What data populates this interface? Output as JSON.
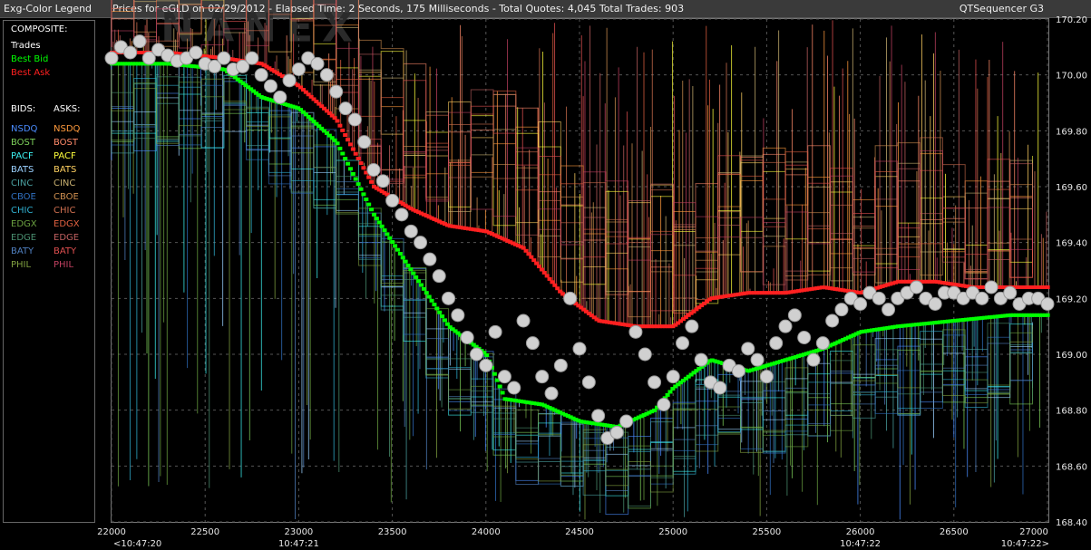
{
  "window": {
    "legend_title": "Exg-Color Legend",
    "chart_title": "Prices for  eGLD  on  02/29/2012  -  Elapsed Time: 2 Seconds, 175 Milliseconds  -  Total Quotes: 4,045  Total Trades: 903",
    "app_name": "QTSequencer G3"
  },
  "legend": {
    "composite_heading": "COMPOSITE:",
    "composite": [
      {
        "label": "Trades",
        "color": "#ffffff"
      },
      {
        "label": "Best Bid",
        "color": "#00ff00"
      },
      {
        "label": "Best Ask",
        "color": "#ff2020"
      }
    ],
    "bids_heading": "BIDS:",
    "asks_heading": "ASKS:",
    "exchanges": [
      {
        "bid": "NSDQ",
        "ask": "NSDQ",
        "bid_color": "#4a8cff",
        "ask_color": "#ff9a3c"
      },
      {
        "bid": "BOST",
        "ask": "BOST",
        "bid_color": "#7ccf5a",
        "ask_color": "#ff8a6a"
      },
      {
        "bid": "PACF",
        "ask": "PACF",
        "bid_color": "#3cf0f0",
        "ask_color": "#ffff3c"
      },
      {
        "bid": "BATS",
        "ask": "BATS",
        "bid_color": "#9ad0ff",
        "ask_color": "#ffd060"
      },
      {
        "bid": "CINC",
        "ask": "CINC",
        "bid_color": "#4aa0a0",
        "ask_color": "#c8b070"
      },
      {
        "bid": "CBOE",
        "ask": "CBOE",
        "bid_color": "#3070c0",
        "ask_color": "#d09050"
      },
      {
        "bid": "CHIC",
        "ask": "CHIC",
        "bid_color": "#30b0d0",
        "ask_color": "#d07050"
      },
      {
        "bid": "EDGX",
        "ask": "EDGX",
        "bid_color": "#6aa040",
        "ask_color": "#e06040"
      },
      {
        "bid": "EDGE",
        "ask": "EDGE",
        "bid_color": "#4a9070",
        "ask_color": "#c06060"
      },
      {
        "bid": "BATY",
        "ask": "BATY",
        "bid_color": "#5080c0",
        "ask_color": "#e05050"
      },
      {
        "bid": "PHIL",
        "ask": "PHIL",
        "bid_color": "#80a040",
        "ask_color": "#c04060"
      }
    ]
  },
  "chart_data": {
    "type": "scatter",
    "watermark": "NANEX",
    "ylim": [
      168.4,
      170.2
    ],
    "xlim": [
      22000,
      27000
    ],
    "y_ticks": [
      "170.20",
      "170.00",
      "169.80",
      "169.60",
      "169.40",
      "169.20",
      "169.00",
      "168.80",
      "168.60",
      "168.40"
    ],
    "y_tick_values": [
      170.2,
      170.0,
      169.8,
      169.6,
      169.4,
      169.2,
      169.0,
      168.8,
      168.6,
      168.4
    ],
    "x_ticks": [
      22000,
      22500,
      23000,
      23500,
      24000,
      24500,
      25000,
      25500,
      26000,
      26500,
      27000
    ],
    "time_labels": [
      {
        "x": 22000,
        "label": "<10:47:20"
      },
      {
        "x": 23000,
        "label": "10:47:21"
      },
      {
        "x": 26000,
        "label": "10:47:22"
      },
      {
        "x": 27000,
        "label": "10:47:22>"
      }
    ],
    "grid": true,
    "series": [
      {
        "name": "Trades",
        "color": "#d0d0d0",
        "points": [
          [
            22000,
            170.06
          ],
          [
            22050,
            170.1
          ],
          [
            22100,
            170.08
          ],
          [
            22150,
            170.12
          ],
          [
            22200,
            170.06
          ],
          [
            22250,
            170.09
          ],
          [
            22300,
            170.07
          ],
          [
            22350,
            170.05
          ],
          [
            22400,
            170.06
          ],
          [
            22450,
            170.08
          ],
          [
            22500,
            170.04
          ],
          [
            22550,
            170.03
          ],
          [
            22600,
            170.06
          ],
          [
            22650,
            170.02
          ],
          [
            22700,
            170.03
          ],
          [
            22750,
            170.06
          ],
          [
            22800,
            170.0
          ],
          [
            22850,
            169.96
          ],
          [
            22900,
            169.92
          ],
          [
            22950,
            169.98
          ],
          [
            23000,
            170.02
          ],
          [
            23050,
            170.06
          ],
          [
            23100,
            170.04
          ],
          [
            23150,
            170.0
          ],
          [
            23200,
            169.94
          ],
          [
            23250,
            169.88
          ],
          [
            23300,
            169.84
          ],
          [
            23350,
            169.76
          ],
          [
            23400,
            169.66
          ],
          [
            23450,
            169.62
          ],
          [
            23500,
            169.55
          ],
          [
            23550,
            169.5
          ],
          [
            23600,
            169.44
          ],
          [
            23650,
            169.4
          ],
          [
            23700,
            169.34
          ],
          [
            23750,
            169.28
          ],
          [
            23800,
            169.2
          ],
          [
            23850,
            169.14
          ],
          [
            23900,
            169.06
          ],
          [
            23950,
            169.0
          ],
          [
            24000,
            168.96
          ],
          [
            24050,
            169.08
          ],
          [
            24100,
            168.92
          ],
          [
            24150,
            168.88
          ],
          [
            24200,
            169.12
          ],
          [
            24250,
            169.04
          ],
          [
            24300,
            168.92
          ],
          [
            24350,
            168.86
          ],
          [
            24400,
            168.96
          ],
          [
            24450,
            169.2
          ],
          [
            24500,
            169.02
          ],
          [
            24550,
            168.9
          ],
          [
            24600,
            168.78
          ],
          [
            24650,
            168.7
          ],
          [
            24700,
            168.72
          ],
          [
            24750,
            168.76
          ],
          [
            24800,
            169.08
          ],
          [
            24850,
            169.0
          ],
          [
            24900,
            168.9
          ],
          [
            24950,
            168.82
          ],
          [
            25000,
            168.92
          ],
          [
            25050,
            169.04
          ],
          [
            25100,
            169.1
          ],
          [
            25150,
            168.98
          ],
          [
            25200,
            168.9
          ],
          [
            25250,
            168.88
          ],
          [
            25300,
            168.96
          ],
          [
            25350,
            168.94
          ],
          [
            25400,
            169.02
          ],
          [
            25450,
            168.98
          ],
          [
            25500,
            168.92
          ],
          [
            25550,
            169.04
          ],
          [
            25600,
            169.1
          ],
          [
            25650,
            169.14
          ],
          [
            25700,
            169.06
          ],
          [
            25750,
            168.98
          ],
          [
            25800,
            169.04
          ],
          [
            25850,
            169.12
          ],
          [
            25900,
            169.16
          ],
          [
            25950,
            169.2
          ],
          [
            26000,
            169.18
          ],
          [
            26050,
            169.22
          ],
          [
            26100,
            169.2
          ],
          [
            26150,
            169.16
          ],
          [
            26200,
            169.2
          ],
          [
            26250,
            169.22
          ],
          [
            26300,
            169.24
          ],
          [
            26350,
            169.2
          ],
          [
            26400,
            169.18
          ],
          [
            26450,
            169.22
          ],
          [
            26500,
            169.22
          ],
          [
            26550,
            169.2
          ],
          [
            26600,
            169.22
          ],
          [
            26650,
            169.2
          ],
          [
            26700,
            169.24
          ],
          [
            26750,
            169.2
          ],
          [
            26800,
            169.22
          ],
          [
            26850,
            169.18
          ],
          [
            26900,
            169.2
          ],
          [
            26950,
            169.2
          ],
          [
            27000,
            169.18
          ]
        ]
      },
      {
        "name": "Best Bid",
        "color": "#00ff00",
        "points": [
          [
            22000,
            170.04
          ],
          [
            22300,
            170.04
          ],
          [
            22600,
            170.02
          ],
          [
            22800,
            169.92
          ],
          [
            23000,
            169.88
          ],
          [
            23200,
            169.76
          ],
          [
            23400,
            169.5
          ],
          [
            23600,
            169.3
          ],
          [
            23800,
            169.1
          ],
          [
            24000,
            169.0
          ],
          [
            24100,
            168.84
          ],
          [
            24300,
            168.82
          ],
          [
            24500,
            168.76
          ],
          [
            24700,
            168.74
          ],
          [
            24900,
            168.8
          ],
          [
            25000,
            168.88
          ],
          [
            25200,
            168.98
          ],
          [
            25400,
            168.94
          ],
          [
            25600,
            168.98
          ],
          [
            25800,
            169.02
          ],
          [
            26000,
            169.08
          ],
          [
            26200,
            169.1
          ],
          [
            26500,
            169.12
          ],
          [
            26800,
            169.14
          ],
          [
            27000,
            169.14
          ]
        ]
      },
      {
        "name": "Best Ask",
        "color": "#ff2020",
        "points": [
          [
            22000,
            170.08
          ],
          [
            22300,
            170.08
          ],
          [
            22600,
            170.06
          ],
          [
            22800,
            170.04
          ],
          [
            23000,
            169.96
          ],
          [
            23200,
            169.84
          ],
          [
            23400,
            169.6
          ],
          [
            23600,
            169.52
          ],
          [
            23800,
            169.46
          ],
          [
            24000,
            169.44
          ],
          [
            24200,
            169.38
          ],
          [
            24400,
            169.22
          ],
          [
            24600,
            169.12
          ],
          [
            24800,
            169.1
          ],
          [
            25000,
            169.1
          ],
          [
            25200,
            169.2
          ],
          [
            25400,
            169.22
          ],
          [
            25600,
            169.22
          ],
          [
            25800,
            169.24
          ],
          [
            26000,
            169.22
          ],
          [
            26200,
            169.26
          ],
          [
            26400,
            169.26
          ],
          [
            26600,
            169.24
          ],
          [
            26800,
            169.24
          ],
          [
            27000,
            169.24
          ]
        ]
      }
    ]
  }
}
